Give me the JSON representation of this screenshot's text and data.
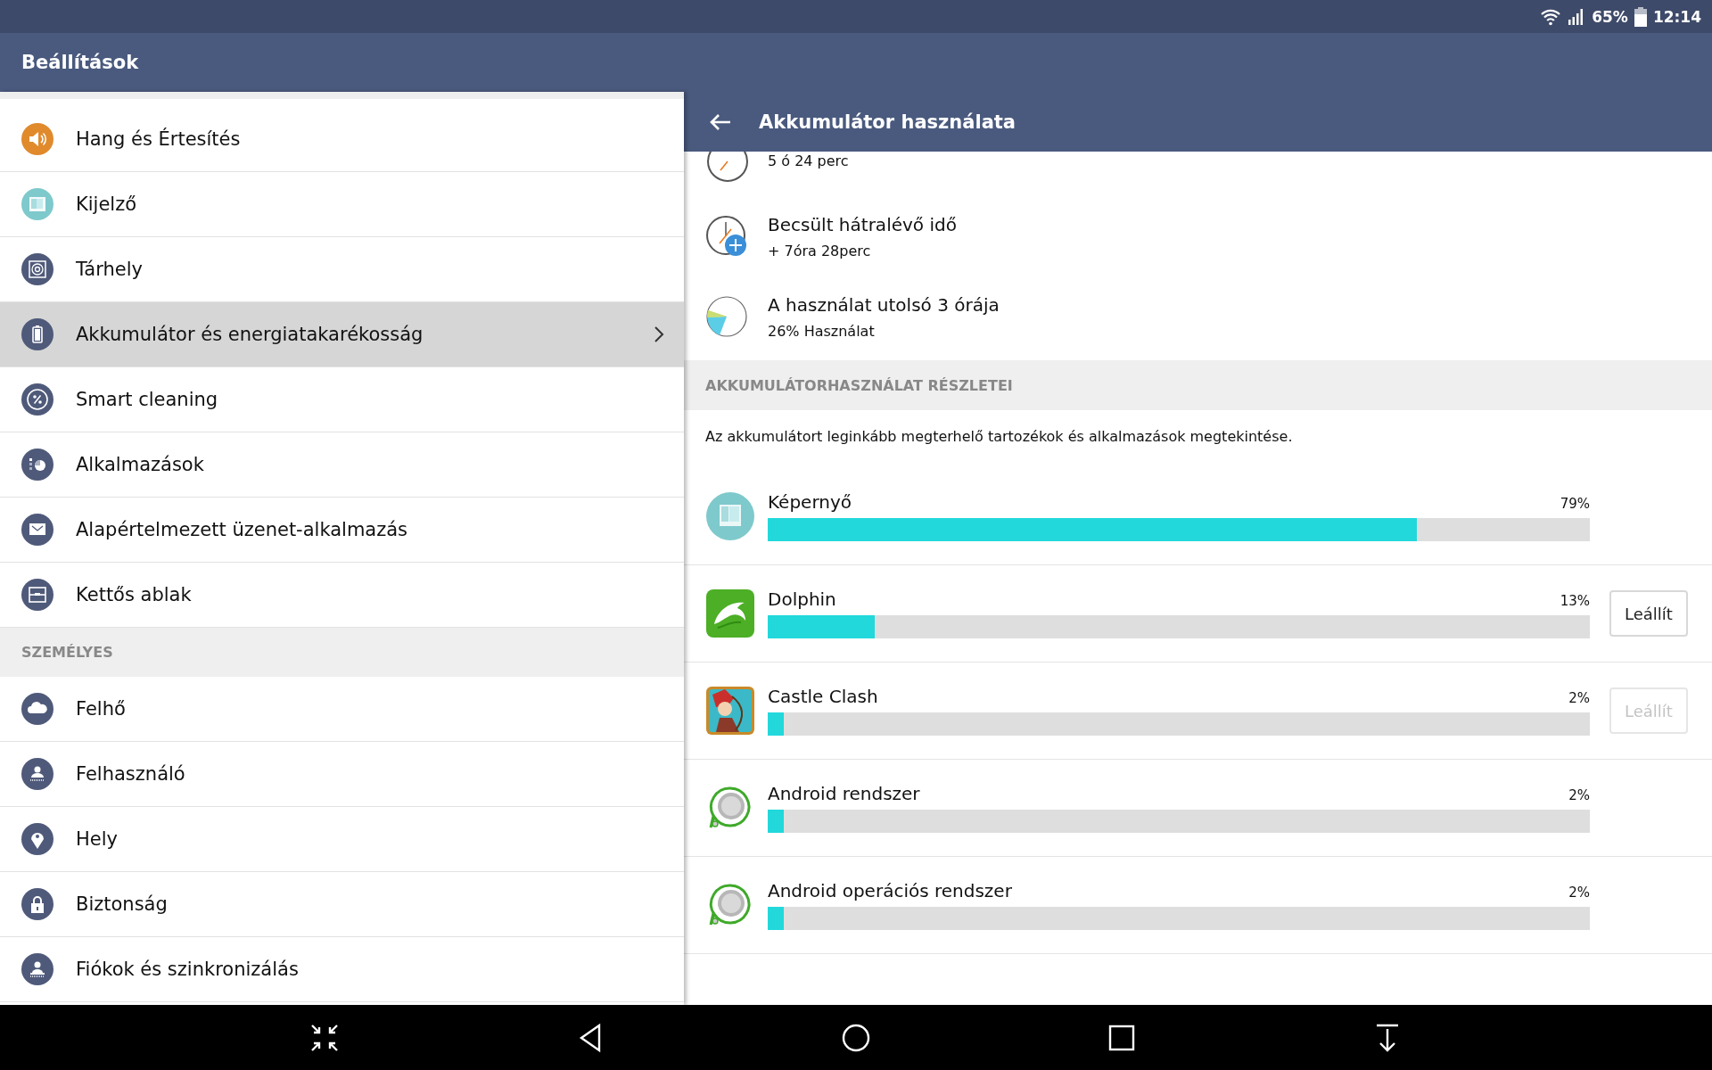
{
  "status_bar": {
    "battery": "65%",
    "time": "12:14"
  },
  "app_bar": {
    "title": "Beállítások"
  },
  "settings_list": {
    "items": [
      {
        "label": "Hang és Értesítés",
        "selected": false
      },
      {
        "label": "Kijelző",
        "selected": false
      },
      {
        "label": "Tárhely",
        "selected": false
      },
      {
        "label": "Akkumulátor és energiatakarékosság",
        "selected": true
      },
      {
        "label": "Smart cleaning",
        "selected": false
      },
      {
        "label": "Alkalmazások",
        "selected": false
      },
      {
        "label": "Alapértelmezett üzenet-alkalmazás",
        "selected": false
      },
      {
        "label": "Kettős ablak",
        "selected": false
      }
    ]
  },
  "personal_section": {
    "header": "SZEMÉLYES",
    "items": [
      {
        "label": "Felhő",
        "selected": false
      },
      {
        "label": "Felhasználó",
        "selected": false
      },
      {
        "label": "Hely",
        "selected": false
      },
      {
        "label": "Biztonság",
        "selected": false
      },
      {
        "label": "Fiókok és szinkronizálás",
        "selected": false
      }
    ]
  },
  "detail": {
    "title": "Akkumulátor használata",
    "summary": [
      {
        "value": "5 ó 24 perc"
      },
      {
        "title": "Becsült hátralévő idő",
        "value": "+ 7óra 28perc"
      },
      {
        "title": "A használat utolsó 3 órája",
        "value": "26% Használat"
      }
    ],
    "section_header": "AKKUMULÁTORHASZNÁLAT RÉSZLETEI",
    "description": "Az akkumulátort leginkább megterhelő tartozékok és alkalmazások megtekintése.",
    "usage": [
      {
        "name": "Képernyő",
        "percent": "79%",
        "level": 0.79
      },
      {
        "name": "Dolphin",
        "percent": "13%",
        "level": 0.13,
        "button": {
          "label": "Leállít",
          "disabled": false
        }
      },
      {
        "name": "Castle Clash",
        "percent": "2%",
        "level": 0.02,
        "button": {
          "label": "Leállít",
          "disabled": true
        }
      },
      {
        "name": "Android rendszer",
        "percent": "2%",
        "level": 0.02
      },
      {
        "name": "Android operációs rendszer",
        "percent": "2%",
        "level": 0.02
      }
    ]
  }
}
